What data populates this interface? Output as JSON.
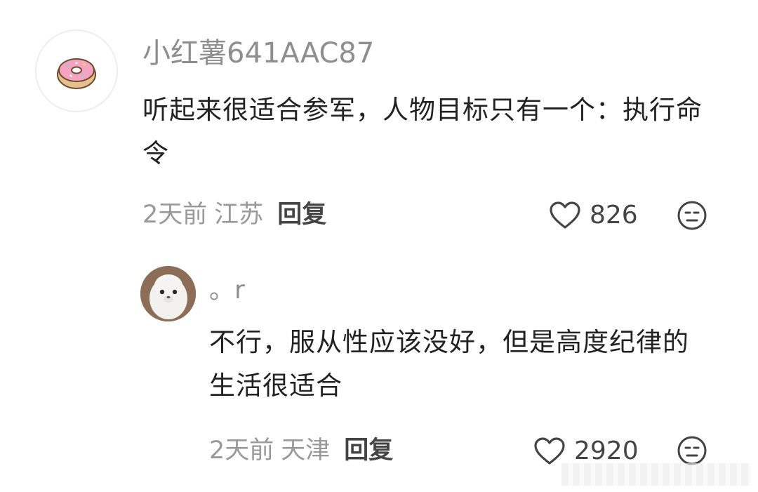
{
  "comments": [
    {
      "username": "小红薯641AAC87",
      "avatar": "donut-avatar",
      "text": "听起来很适合参军，人物目标只有一个：执行命令",
      "time": "2天前",
      "region": "江苏",
      "reply_label": "回复",
      "likes": "826"
    },
    {
      "username": "。r",
      "avatar": "seal-avatar",
      "text": "不行，服从性应该没好，但是高度纪律的生活很适合",
      "time": "2天前",
      "region": "天津",
      "reply_label": "回复",
      "likes": "2920"
    }
  ],
  "icons": {
    "like": "heart-outline-icon",
    "dislike": "neutral-face-icon"
  },
  "colors": {
    "text": "#222222",
    "meta": "#999999",
    "username": "#8e8e8e"
  }
}
